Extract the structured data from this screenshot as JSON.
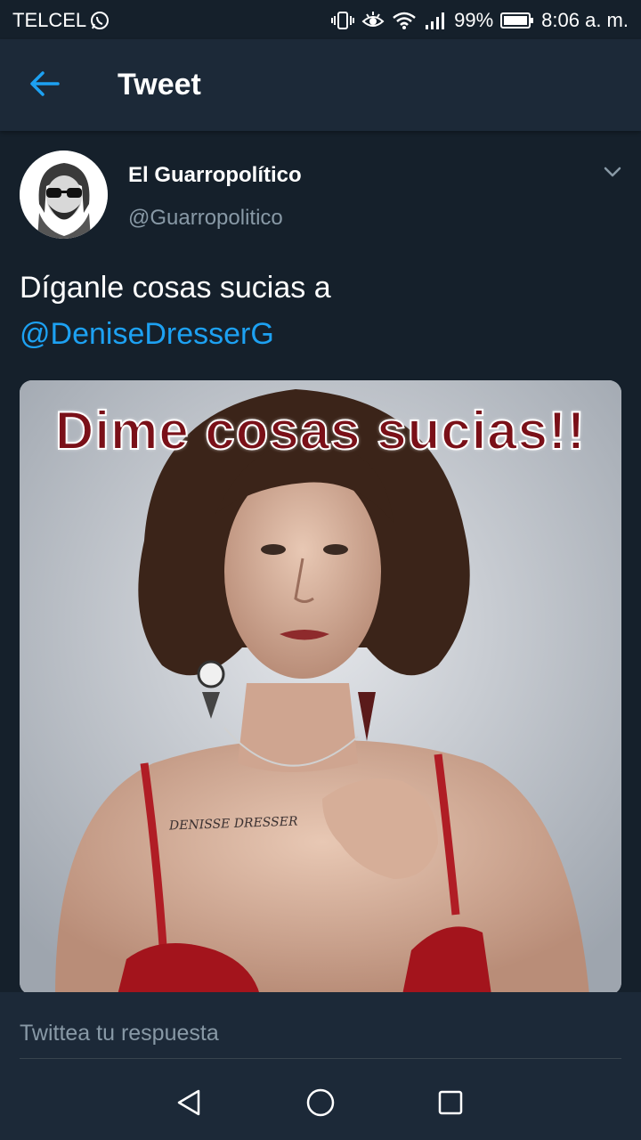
{
  "status_bar": {
    "carrier": "TELCEL",
    "battery": "99%",
    "time": "8:06 a. m.",
    "icons": [
      "whatsapp-icon",
      "vibrate-icon",
      "eye-comfort-icon",
      "wifi-icon",
      "signal-icon",
      "battery-icon"
    ]
  },
  "header": {
    "title": "Tweet",
    "back_icon": "arrow-left-icon",
    "accent": "#1da1f2"
  },
  "tweet": {
    "author_name": "El Guarropolítico",
    "author_handle": "@Guarropolitico",
    "text_prefix": "Díganle cosas sucias a",
    "mention": "@DeniseDresserG",
    "media": {
      "caption": "Dime cosas sucias!!",
      "tattoo": "DENISSE DRESSER"
    }
  },
  "reply": {
    "placeholder": "Twittea tu respuesta"
  },
  "nav": {
    "icons": [
      "back-triangle-icon",
      "home-circle-icon",
      "recents-square-icon"
    ]
  },
  "colors": {
    "background": "#15202b",
    "header": "#1c2938",
    "secondary_text": "#8899a6",
    "mention": "#1da1f2"
  }
}
